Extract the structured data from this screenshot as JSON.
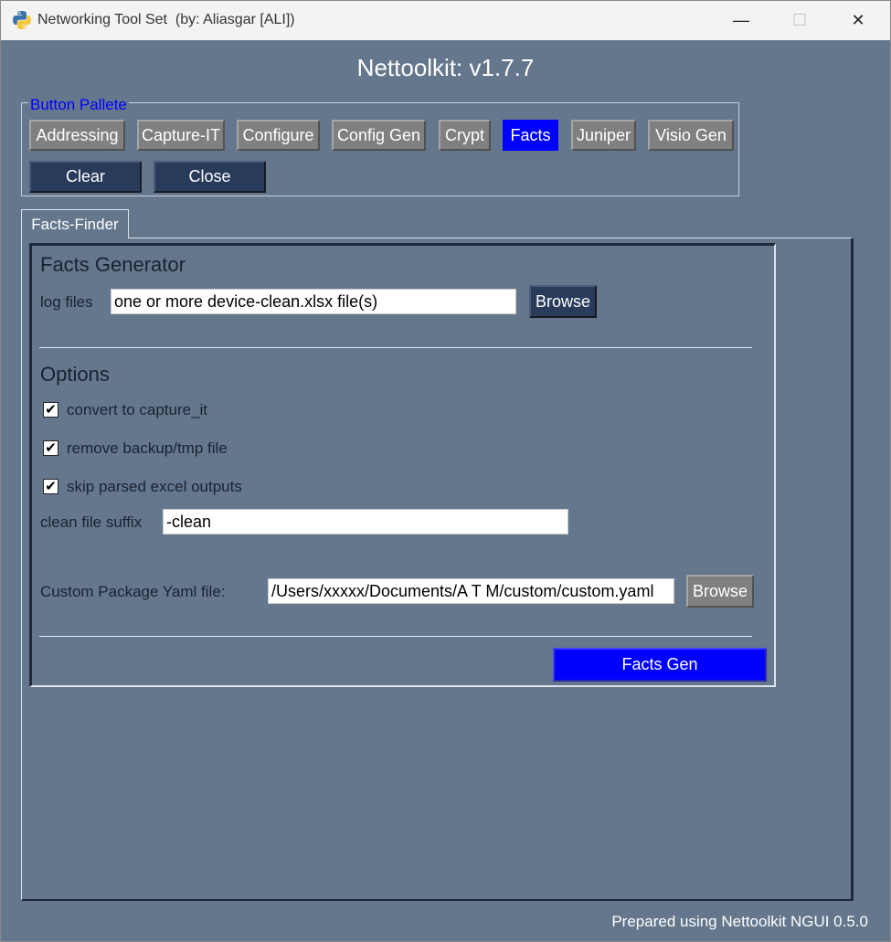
{
  "window": {
    "title": "Networking Tool Set  (by: Aliasgar [ALI])",
    "minimize_glyph": "—",
    "maximize_glyph": "☐",
    "close_glyph": "✕",
    "app_icon": "python-logo-icon"
  },
  "app_title": "Nettoolkit: v1.7.7",
  "palette": {
    "legend": "Button Pallete",
    "buttons": [
      "Addressing",
      "Capture-IT",
      "Configure",
      "Config Gen",
      "Crypt",
      "Facts",
      "Juniper",
      "Visio Gen"
    ],
    "active_button": "Facts",
    "clear_label": "Clear",
    "close_label": "Close"
  },
  "tab": {
    "label": "Facts-Finder"
  },
  "facts": {
    "heading": "Facts Generator",
    "log_files_label": "log files",
    "log_files_value": "one or more device-clean.xlsx file(s)",
    "browse_label": "Browse",
    "options_heading": "Options",
    "options": [
      {
        "label": "convert to capture_it",
        "checked": true
      },
      {
        "label": "remove backup/tmp file",
        "checked": true
      },
      {
        "label": "skip parsed excel outputs",
        "checked": true
      }
    ],
    "check_glyph": "✔",
    "suffix_label": "clean file suffix",
    "suffix_value": "-clean",
    "yaml_label": "Custom Package Yaml file:",
    "yaml_value": "/Users/xxxxx/Documents/A T M/custom/custom.yaml",
    "yaml_browse_label": "Browse",
    "generate_label": "Facts Gen"
  },
  "footer": "Prepared using Nettoolkit NGUI 0.5.0",
  "colors": {
    "window_bg": "#64778d",
    "accent_blue": "#0000ff",
    "dark_button": "#283b5b",
    "gray_button": "#808080"
  }
}
